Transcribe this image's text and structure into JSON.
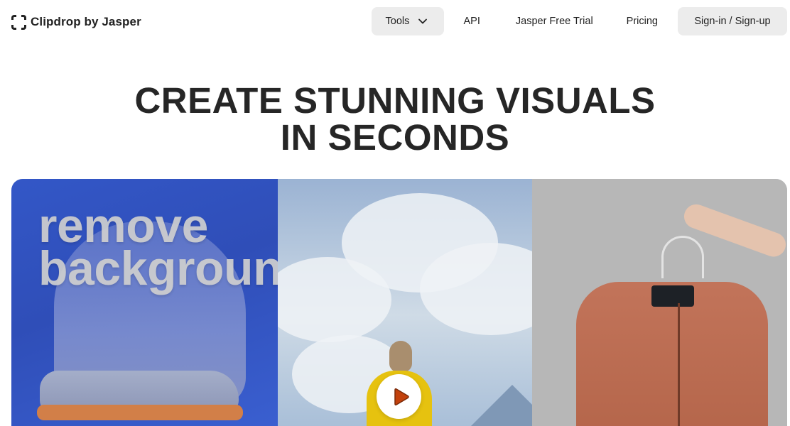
{
  "header": {
    "brand": "Clipdrop by Jasper",
    "nav": {
      "tools_label": "Tools",
      "api_label": "API",
      "trial_label": "Jasper Free Trial",
      "pricing_label": "Pricing",
      "signin_label": "Sign-in / Sign-up"
    }
  },
  "hero": {
    "title_line1": "CREATE STUNNING VISUALS",
    "title_line2": "IN SECONDS"
  },
  "media": {
    "overlay_line1": "remove",
    "overlay_line2": "background",
    "play_icon": "play-icon"
  },
  "colors": {
    "accent_play": "#c2410c",
    "nav_button_bg": "#ececec",
    "text_dark": "#262626"
  }
}
